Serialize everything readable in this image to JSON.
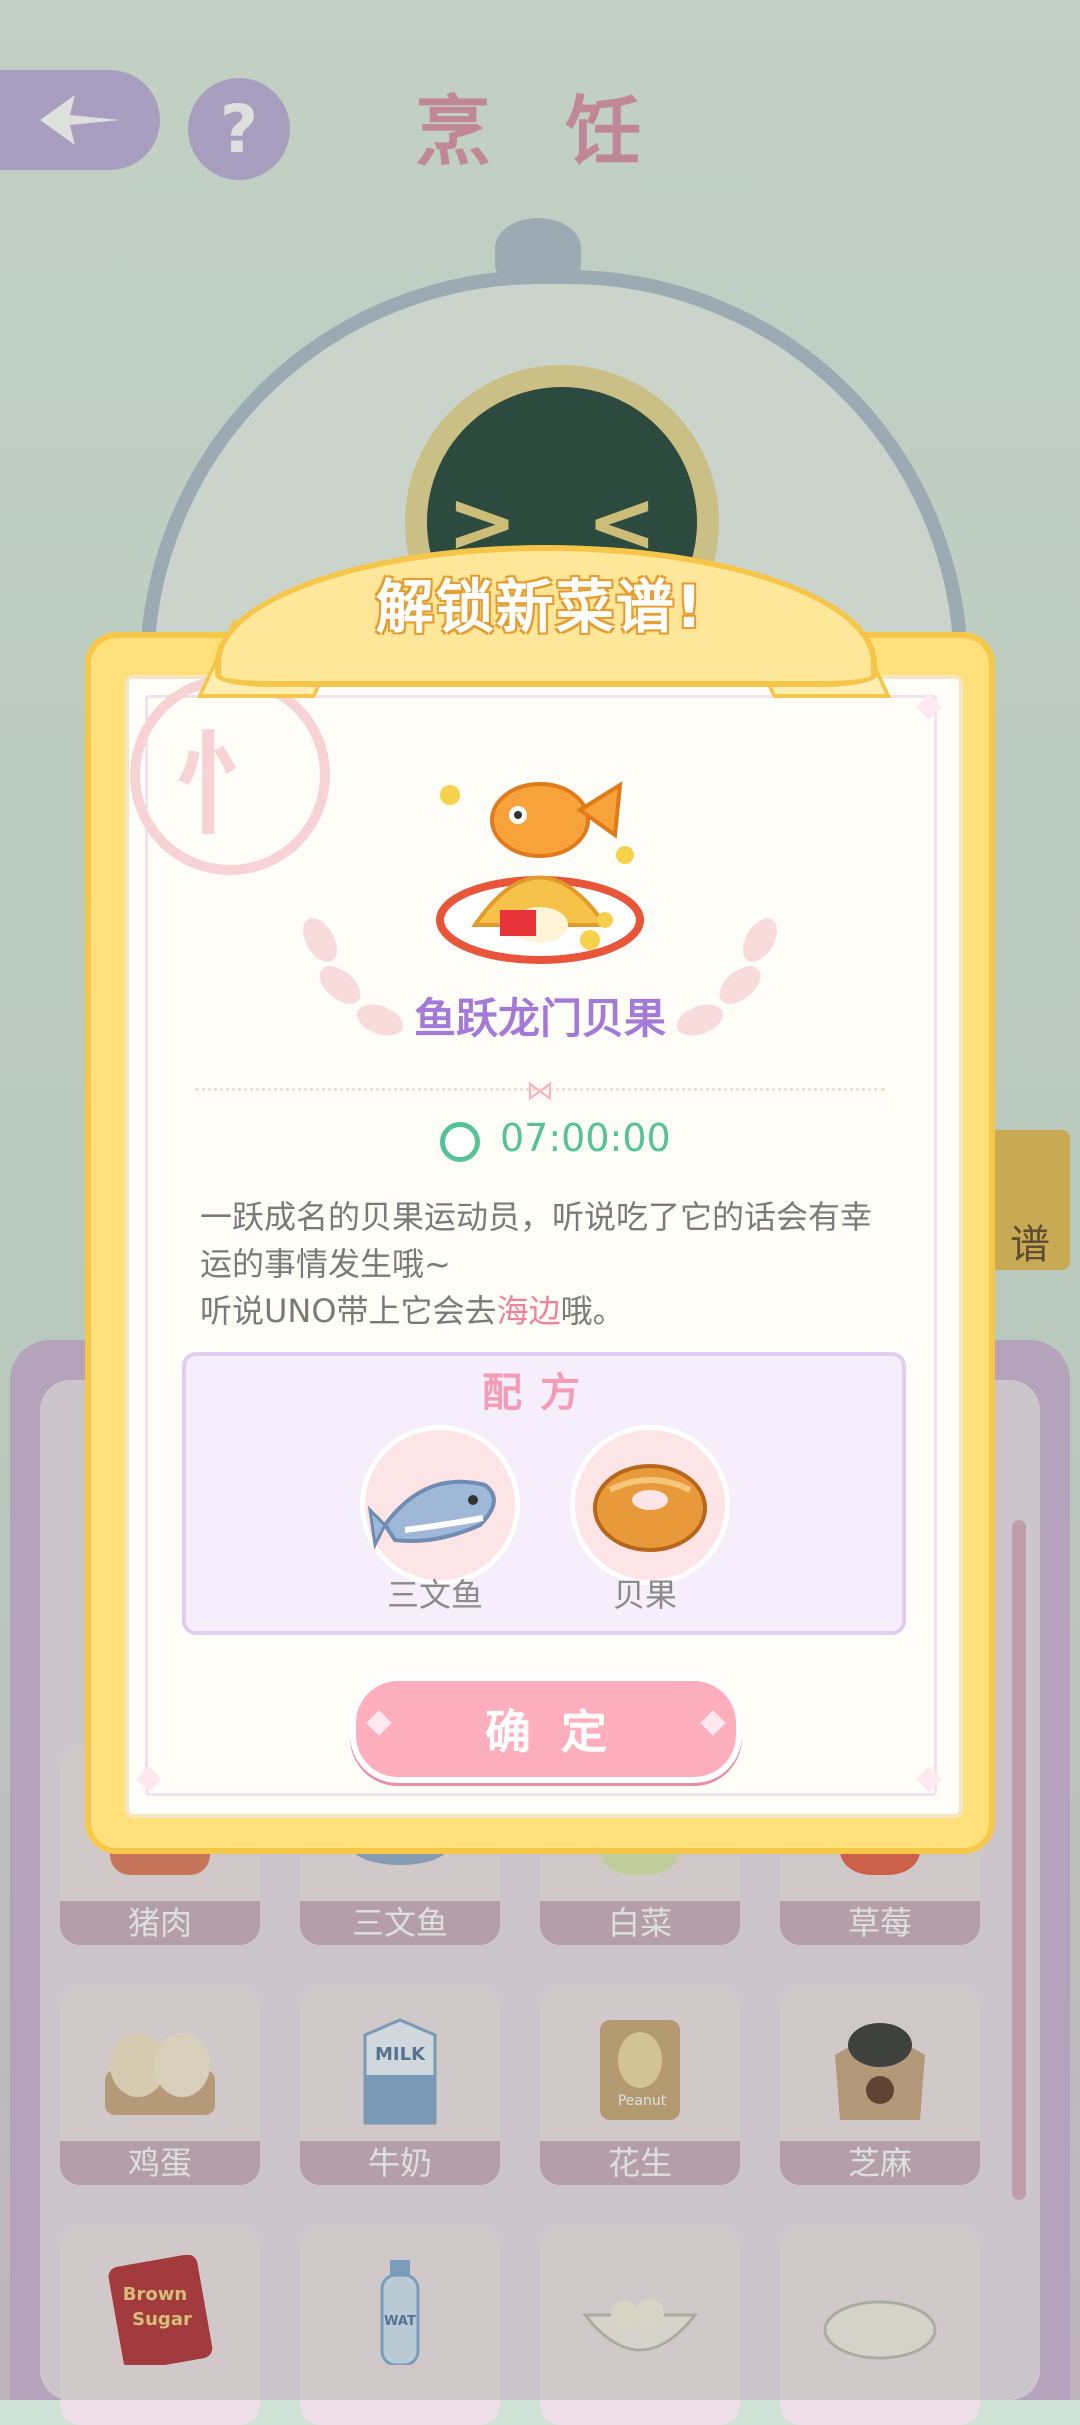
{
  "header": {
    "title": "烹 饪",
    "back_icon": "back-arrow-icon",
    "help_label": "?"
  },
  "background": {
    "robot_face_text": "> <",
    "side_tab_label": "谱"
  },
  "inventory": {
    "rows": [
      [
        {
          "name": "猪肉",
          "icon": "pork-icon"
        },
        {
          "name": "三文鱼",
          "icon": "salmon-icon"
        },
        {
          "name": "白菜",
          "icon": "cabbage-icon"
        },
        {
          "name": "草莓",
          "icon": "strawberry-icon"
        }
      ],
      [
        {
          "name": "鸡蛋",
          "icon": "egg-icon"
        },
        {
          "name": "牛奶",
          "icon": "milk-icon"
        },
        {
          "name": "花生",
          "icon": "peanut-icon"
        },
        {
          "name": "芝麻",
          "icon": "sesame-icon"
        }
      ],
      [
        {
          "name": "",
          "icon": "brown-sugar-icon"
        },
        {
          "name": "",
          "icon": "water-bottle-icon"
        },
        {
          "name": "",
          "icon": "flour-bowl-icon"
        },
        {
          "name": "",
          "icon": "plate-icon"
        }
      ]
    ],
    "package_text": {
      "milk": "MILK",
      "peanut": "Peanut",
      "sugar_line1": "Brown",
      "sugar_line2": "Sugar",
      "water": "WAT"
    }
  },
  "dialog": {
    "title": "解锁新菜谱!",
    "logo_glyph": "忄",
    "recipe_name": "鱼跃龙门贝果",
    "timer": "07:00:00",
    "description_line1": "一跃成名的贝果运动员，听说吃了它的话会有幸运的事情发生哦~",
    "description_line2_prefix": "听说UNO带上它会去",
    "description_line2_highlight": "海边",
    "description_line2_suffix": "哦。",
    "formula_title": "配方",
    "ingredients": [
      {
        "name": "三文鱼",
        "icon": "salmon-icon"
      },
      {
        "name": "贝果",
        "icon": "bagel-icon"
      }
    ],
    "confirm_label": "确定"
  },
  "colors": {
    "accent_purple": "#a47ad8",
    "timer_green": "#55c29a",
    "highlight_pink": "#f07fa0",
    "frame_yellow": "#ffe07a",
    "button_pink": "#ffaebd"
  }
}
